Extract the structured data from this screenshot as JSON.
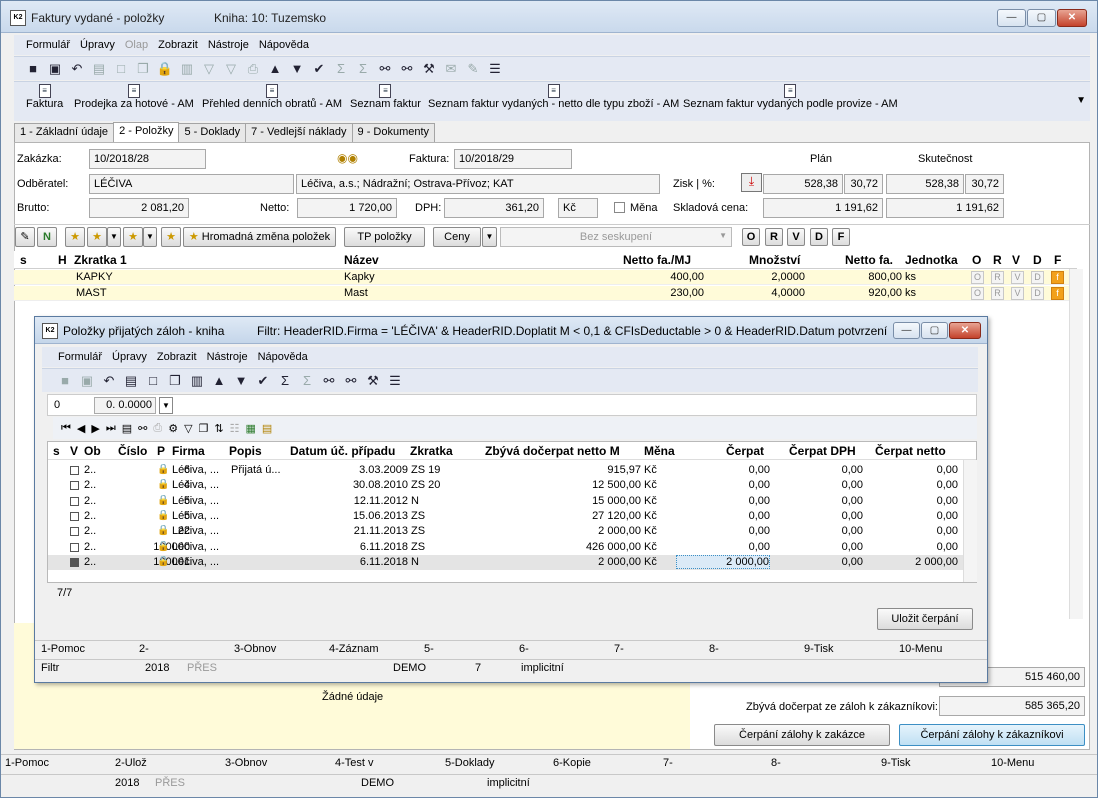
{
  "window": {
    "icon": "K2",
    "title": "Faktury vydané - položky",
    "book": "Kniha: 10: Tuzemsko",
    "min": "—",
    "max": "▢",
    "close": "✕"
  },
  "menu": [
    "Formulář",
    "Úpravy",
    "Olap",
    "Zobrazit",
    "Nástroje",
    "Nápověda"
  ],
  "reports": [
    "Faktura",
    "Prodejka za hotové - AM",
    "Přehled denních obratů - AM",
    "Seznam faktur",
    "Seznam faktur vydaných - netto dle typu zboží - AM",
    "Seznam faktur vydaných podle provize - AM"
  ],
  "tabs": [
    "1 - Základní údaje",
    "2 - Položky",
    "5 - Doklady",
    "7 - Vedlejší náklady",
    "9 - Dokumenty"
  ],
  "form": {
    "zakazka_label": "Zakázka:",
    "zakazka": "10/2018/28",
    "faktura_label": "Faktura:",
    "faktura": "10/2018/29",
    "odberatel_label": "Odběratel:",
    "odberatel": "LÉČIVA",
    "odberatel_desc": "Léčiva, a.s.; Nádražní; Ostrava-Přívoz; KAT",
    "brutto_label": "Brutto:",
    "brutto": "2 081,20",
    "netto_label": "Netto:",
    "netto": "1 720,00",
    "dph_label": "DPH:",
    "dph": "361,20",
    "mena": "Kč",
    "mena_chk": "Měna",
    "plan": "Plán",
    "skutecnost": "Skutečnost",
    "zisk_label": "Zisk | %:",
    "zisk_plan": "528,38",
    "zisk_plan_pct": "30,72",
    "zisk_sk": "528,38",
    "zisk_sk_pct": "30,72",
    "sklad_label": "Skladová cena:",
    "sklad_plan": "1 191,62",
    "sklad_sk": "1 191,62"
  },
  "grid_toolbar": {
    "hromadna": "Hromadná změna položek",
    "tp": "TP položky",
    "ceny": "Ceny",
    "seskupeni": "Bez seskupení",
    "flags": [
      "O",
      "R",
      "V",
      "D",
      "F"
    ]
  },
  "grid": {
    "headers": [
      "s",
      "H",
      "Zkratka 1",
      "Název",
      "Netto fa./MJ",
      "Množství",
      "Netto fa.",
      "Jednotka",
      "O",
      "R",
      "V",
      "D",
      "F"
    ],
    "rows": [
      {
        "zkratka": "KAPKY",
        "nazev": "Kapky",
        "netto_mj": "400,00",
        "mnozstvi": "2,0000",
        "netto": "800,00",
        "jednotka": "ks"
      },
      {
        "zkratka": "MAST",
        "nazev": "Mast",
        "netto_mj": "230,00",
        "mnozstvi": "4,0000",
        "netto": "920,00",
        "jednotka": "ks"
      }
    ]
  },
  "bottom": {
    "no_data": "Žádné údaje",
    "val1": "515 460,00",
    "zbyva_label": "Zbývá dočerpat ze záloh k zákazníkovi:",
    "zbyva": "585 365,20",
    "btn_zakazka": "Čerpání zálohy k zakázce",
    "btn_zakaznik": "Čerpání zálohy k zákazníkovi"
  },
  "status1": [
    "1-Pomoc",
    "2-Ulož",
    "3-Obnov",
    "4-Test v",
    "5-Doklady",
    "6-Kopie",
    "7-",
    "8-",
    "9-Tisk",
    "10-Menu"
  ],
  "status2": [
    "2018",
    "PŘES",
    "DEMO",
    "implicitní"
  ],
  "dialog": {
    "icon": "K2",
    "title": "Položky přijatých záloh - kniha",
    "filter": "Filtr: HeaderRID.Firma = 'LÉČIVA' & HeaderRID.Doplatit M < 0,1 & CFIsDeductable > 0 & HeaderRID.Datum potvrzení...",
    "min": "—",
    "max": "▢",
    "close": "✕",
    "menu": [
      "Formulář",
      "Úpravy",
      "Zobrazit",
      "Nástroje",
      "Nápověda"
    ],
    "book": "0",
    "rate": "0. 0.0000",
    "headers": [
      "s",
      "V",
      "Ob",
      "Číslo",
      "P",
      "Firma",
      "Popis",
      "Datum úč. případu",
      "Zkratka",
      "Zbývá dočerpat netto M",
      "Měna",
      "Čerpat",
      "Čerpat DPH",
      "Čerpat netto"
    ],
    "rows": [
      {
        "ob": "2..",
        "cislo": "6",
        "firma": "Léčiva, ...",
        "popis": "Přijatá ú...",
        "datum": "3.03.2009",
        "zkratka": "ZS 19",
        "zbyva": "915,97",
        "mena": "Kč",
        "cerpat": "0,00",
        "dph": "0,00",
        "netto": "0,00"
      },
      {
        "ob": "2..",
        "cislo": "4",
        "firma": "Léčiva, ...",
        "popis": "",
        "datum": "30.08.2010",
        "zkratka": "ZS 20",
        "zbyva": "12 500,00",
        "mena": "Kč",
        "cerpat": "0,00",
        "dph": "0,00",
        "netto": "0,00"
      },
      {
        "ob": "2..",
        "cislo": "5",
        "firma": "Léčiva, ...",
        "popis": "",
        "datum": "12.11.2012",
        "zkratka": "N",
        "zbyva": "15 000,00",
        "mena": "Kč",
        "cerpat": "0,00",
        "dph": "0,00",
        "netto": "0,00"
      },
      {
        "ob": "2..",
        "cislo": "5",
        "firma": "Léčiva, ...",
        "popis": "",
        "datum": "15.06.2013",
        "zkratka": "ZS",
        "zbyva": "27 120,00",
        "mena": "Kč",
        "cerpat": "0,00",
        "dph": "0,00",
        "netto": "0,00"
      },
      {
        "ob": "2..",
        "cislo": "22",
        "firma": "Léčiva, ...",
        "popis": "",
        "datum": "21.11.2013",
        "zkratka": "ZS",
        "zbyva": "2 000,00",
        "mena": "Kč",
        "cerpat": "0,00",
        "dph": "0,00",
        "netto": "0,00"
      },
      {
        "ob": "2..",
        "cislo": "100000",
        "firma": "Léčiva, ...",
        "popis": "",
        "datum": "6.11.2018",
        "zkratka": "ZS",
        "zbyva": "426 000,00",
        "mena": "Kč",
        "cerpat": "0,00",
        "dph": "0,00",
        "netto": "0,00"
      },
      {
        "ob": "2..",
        "cislo": "100001",
        "firma": "Léčiva, ...",
        "popis": "",
        "datum": "6.11.2018",
        "zkratka": "N",
        "zbyva": "2 000,00",
        "mena": "Kč",
        "cerpat": "2 000,00",
        "dph": "0,00",
        "netto": "2 000,00"
      }
    ],
    "count": "7/7",
    "save": "Uložit čerpání",
    "status1": [
      "1-Pomoc",
      "2-",
      "3-Obnov",
      "4-Záznam",
      "5-",
      "6-",
      "7-",
      "8-",
      "9-Tisk",
      "10-Menu"
    ],
    "status2": [
      "Filtr",
      "2018",
      "PŘES",
      "DEMO",
      "7",
      "implicitní"
    ]
  }
}
